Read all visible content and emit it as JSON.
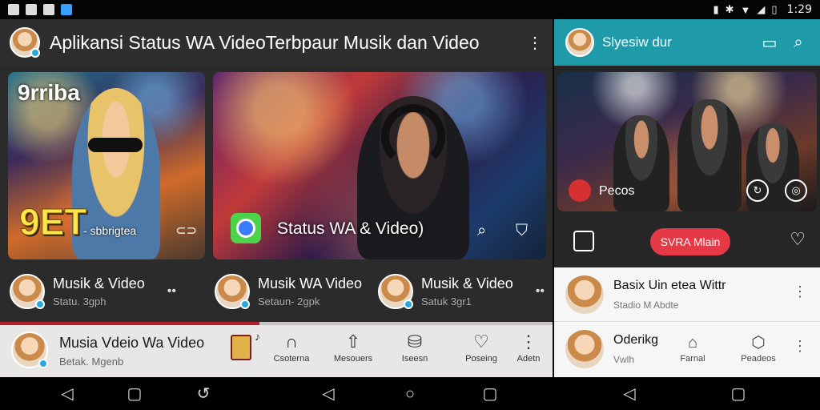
{
  "status_bar": {
    "time": "1:29",
    "left_icons": [
      "notification-icon",
      "photo-icon",
      "gallery-icon",
      "app-icon"
    ],
    "right_icons": [
      "battery-saver-icon",
      "bluetooth-icon",
      "wifi-icon",
      "signal-icon",
      "battery-icon"
    ]
  },
  "left_app": {
    "title": "Aplikansi Status WA VideoTerbpaur Musik  dan Video",
    "cards": [
      {
        "badge": "9rriba",
        "big_text": "9ET",
        "caption": "- sbbrigtea",
        "link_icon": "link-icon"
      },
      {
        "caption": "Status WA & Video)",
        "icons": [
          "search-icon",
          "shield-icon"
        ]
      }
    ],
    "mini_rows": [
      {
        "title": "Musik & Video",
        "subtitle": "Statu. 3gph",
        "more": "••"
      },
      {
        "title": "Musik WA Video",
        "subtitle": "Setaun- 2gpk",
        "more": ""
      },
      {
        "title": "Musik & Video",
        "subtitle": "Satuk 3gr1",
        "more": "••"
      }
    ],
    "player": {
      "title": "Musia Vdeio Wa Video",
      "subtitle": "Betak. Mgenb",
      "progress": 0.47,
      "note_icon": "♪",
      "nav": [
        {
          "label": "Csoterna",
          "icon": "headphones-icon"
        },
        {
          "label": "Mesouers",
          "icon": "arrow-up-icon"
        },
        {
          "label": "Iseesn",
          "icon": "database-icon"
        },
        {
          "label": "Poseing",
          "icon": "heart-icon"
        },
        {
          "label": "Adetn",
          "icon": "more-icon"
        }
      ]
    }
  },
  "right_app": {
    "title": "Slyesiw dur",
    "stage_caption": "Pecos",
    "action_button": "SVRA Mlain",
    "list": [
      {
        "title": "Basix Uin  etea Wittr",
        "subtitle": "Stadio M Abdte"
      },
      {
        "title": "Oderikg",
        "subtitle": "Vwlh",
        "nav": [
          {
            "label": "Farnal",
            "icon": "home-icon"
          },
          {
            "label": "Peadeos",
            "icon": "hexagon-icon"
          }
        ]
      }
    ]
  },
  "colors": {
    "accent_teal": "#1f9aa8",
    "accent_red": "#e53945",
    "progress_red": "#b2202a"
  }
}
